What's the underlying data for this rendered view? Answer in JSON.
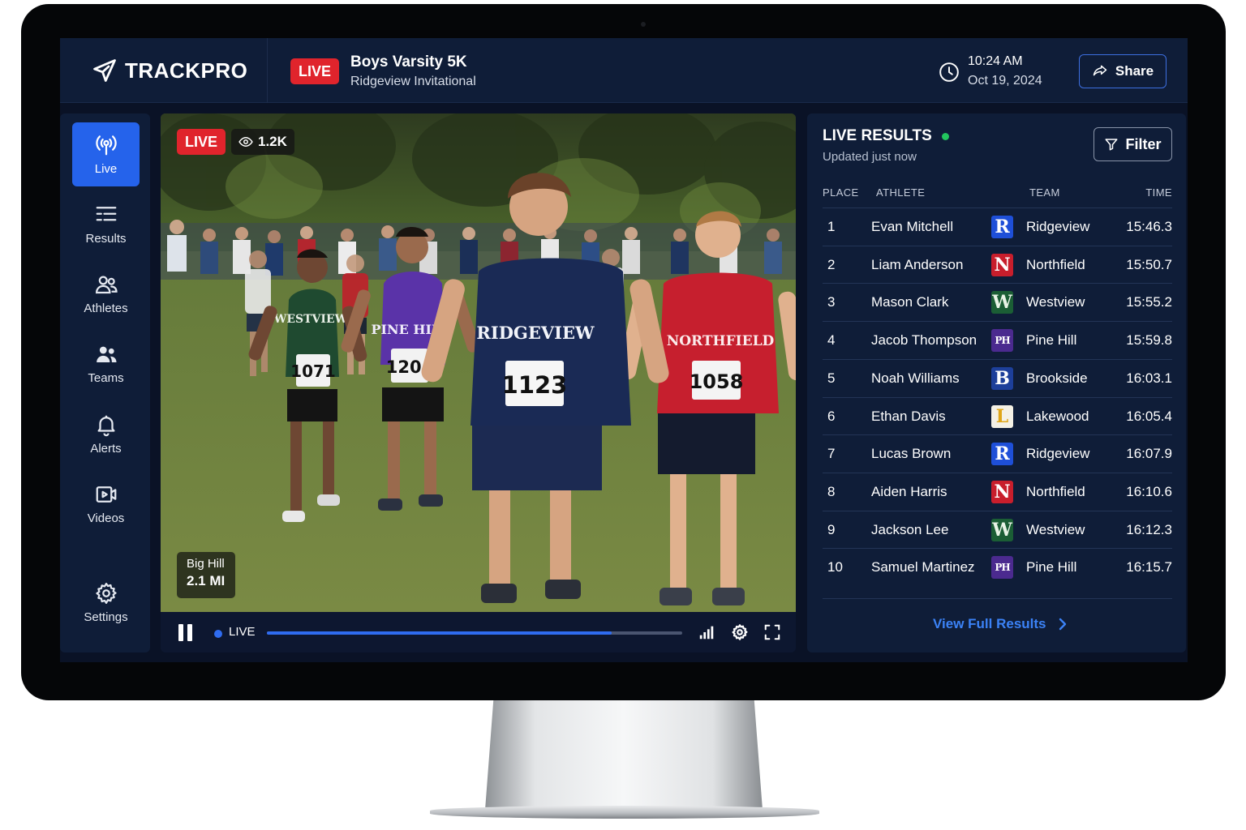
{
  "brand": {
    "name": "TRACKPRO"
  },
  "header": {
    "live_badge": "LIVE",
    "event_title": "Boys Varsity 5K",
    "event_subtitle": "Ridgeview Invitational",
    "time": "10:24 AM",
    "date": "Oct 19, 2024",
    "share_label": "Share"
  },
  "sidebar": {
    "items": [
      {
        "label": "Live",
        "icon": "broadcast-icon",
        "active": true
      },
      {
        "label": "Results",
        "icon": "list-icon"
      },
      {
        "label": "Athletes",
        "icon": "athletes-icon"
      },
      {
        "label": "Teams",
        "icon": "teams-icon"
      },
      {
        "label": "Alerts",
        "icon": "bell-icon"
      },
      {
        "label": "Videos",
        "icon": "video-icon"
      },
      {
        "label": "Settings",
        "icon": "gear-icon"
      }
    ]
  },
  "video": {
    "live_badge": "LIVE",
    "viewers": "1.2K",
    "location_name": "Big Hill",
    "location_distance": "2.1 MI",
    "live_label": "LIVE",
    "progress": 0.83,
    "scene_text": {
      "front_runner_jersey": "RIDGEVIEW",
      "front_runner_bib": "1123",
      "right_runner_jersey": "NORTHFIELD",
      "right_runner_bib": "1058",
      "mid_runner_jersey": "PINE HILL",
      "mid_runner_bib": "1204",
      "left_runner_jersey": "WESTVIEW",
      "left_runner_bib": "1071"
    }
  },
  "results": {
    "title": "LIVE RESULTS",
    "updated": "Updated just now",
    "filter_label": "Filter",
    "columns": {
      "place": "PLACE",
      "athlete": "ATHLETE",
      "team": "TEAM",
      "time": "TIME"
    },
    "rows": [
      {
        "place": "1",
        "athlete": "Evan Mitchell",
        "team": "Ridgeview",
        "logo": "R",
        "logo_color": "#1e4fd8",
        "logo_text": "#ffffff",
        "time": "15:46.3"
      },
      {
        "place": "2",
        "athlete": "Liam Anderson",
        "team": "Northfield",
        "logo": "N",
        "logo_color": "#c81e2c",
        "logo_text": "#ffffff",
        "time": "15:50.7"
      },
      {
        "place": "3",
        "athlete": "Mason Clark",
        "team": "Westview",
        "logo": "W",
        "logo_color": "#1b5e35",
        "logo_text": "#e8f3e6",
        "time": "15:55.2"
      },
      {
        "place": "4",
        "athlete": "Jacob Thompson",
        "team": "Pine Hill",
        "logo": "PH",
        "logo_color": "#4b2a8f",
        "logo_text": "#ffffff",
        "time": "15:59.8"
      },
      {
        "place": "5",
        "athlete": "Noah Williams",
        "team": "Brookside",
        "logo": "B",
        "logo_color": "#1d3f9a",
        "logo_text": "#ffffff",
        "time": "16:03.1"
      },
      {
        "place": "6",
        "athlete": "Ethan Davis",
        "team": "Lakewood",
        "logo": "L",
        "logo_color": "#f4f1e6",
        "logo_text": "#e0a618",
        "time": "16:05.4"
      },
      {
        "place": "7",
        "athlete": "Lucas Brown",
        "team": "Ridgeview",
        "logo": "R",
        "logo_color": "#1e4fd8",
        "logo_text": "#ffffff",
        "time": "16:07.9"
      },
      {
        "place": "8",
        "athlete": "Aiden Harris",
        "team": "Northfield",
        "logo": "N",
        "logo_color": "#c81e2c",
        "logo_text": "#ffffff",
        "time": "16:10.6"
      },
      {
        "place": "9",
        "athlete": "Jackson Lee",
        "team": "Westview",
        "logo": "W",
        "logo_color": "#1b5e35",
        "logo_text": "#e8f3e6",
        "time": "16:12.3"
      },
      {
        "place": "10",
        "athlete": "Samuel Martinez",
        "team": "Pine Hill",
        "logo": "PH",
        "logo_color": "#4b2a8f",
        "logo_text": "#ffffff",
        "time": "16:15.7"
      }
    ],
    "view_full_label": "View Full Results"
  },
  "colors": {
    "accent": "#2563eb",
    "live_red": "#e0242c",
    "status_green": "#22c55e",
    "panel": "#0f1d38"
  }
}
